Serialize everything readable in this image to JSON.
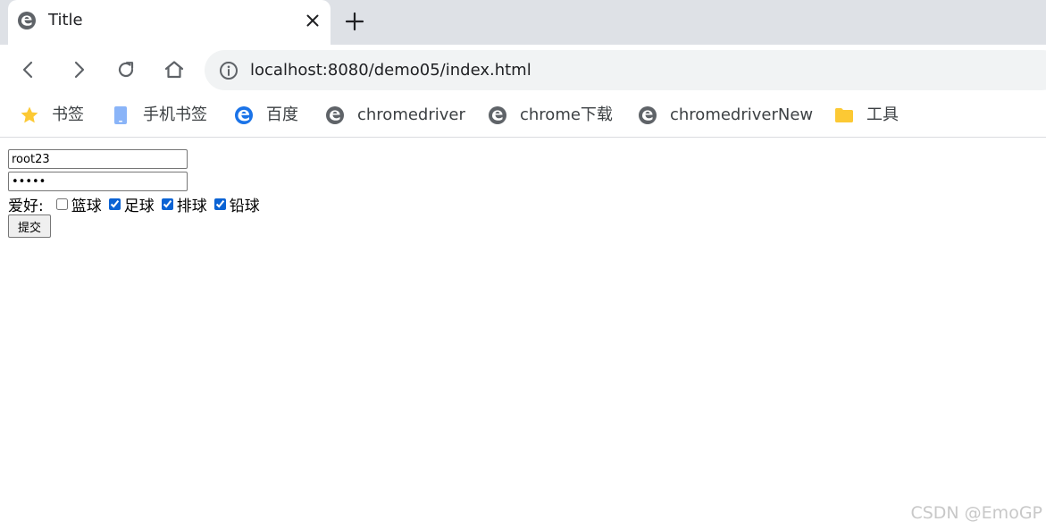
{
  "tab": {
    "title": "Title"
  },
  "omnibox": {
    "url": "localhost:8080/demo05/index.html"
  },
  "bookmarks": [
    {
      "label": "书签",
      "icon": "star-icon"
    },
    {
      "label": "手机书签",
      "icon": "phone-icon"
    },
    {
      "label": "百度",
      "icon": "edge-icon"
    },
    {
      "label": "chromedriver",
      "icon": "site-e-icon"
    },
    {
      "label": "chrome下载",
      "icon": "site-e-icon"
    },
    {
      "label": "chromedriverNew",
      "icon": "site-e-icon"
    },
    {
      "label": "工具",
      "icon": "folder-icon"
    }
  ],
  "form": {
    "username": "root23",
    "password": "12345",
    "hobby_label": "爱好:",
    "hobbies": [
      {
        "label": "篮球",
        "checked": false
      },
      {
        "label": "足球",
        "checked": true
      },
      {
        "label": "排球",
        "checked": true
      },
      {
        "label": "铅球",
        "checked": true
      }
    ],
    "submit_label": "提交"
  },
  "watermark": "CSDN @EmoGP",
  "colors": {
    "star": "#fcc934",
    "folder": "#fcc934",
    "phone": "#8ab4f8",
    "edge": "#1a73e8",
    "checkbox": "#0b63d4"
  }
}
